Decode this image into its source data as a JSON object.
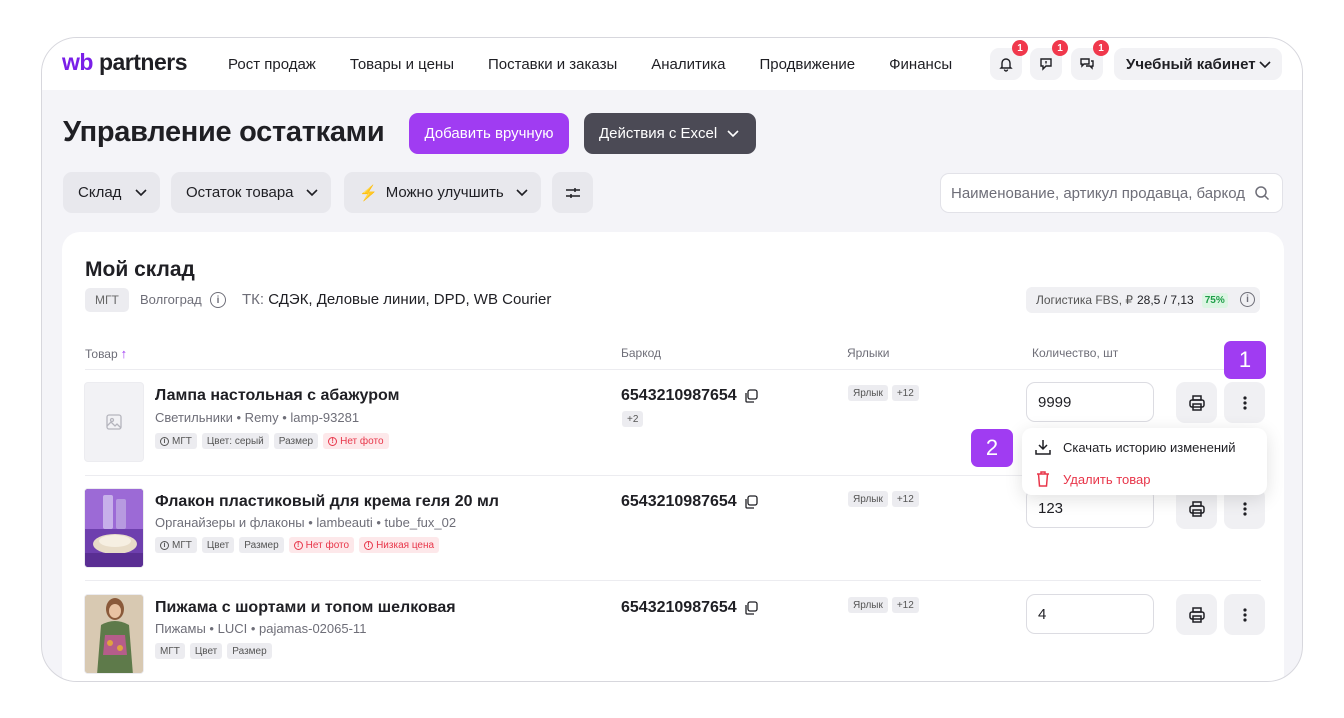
{
  "logo": {
    "wb": "wb",
    "partners": "partners"
  },
  "nav": [
    {
      "label": "Рост продаж"
    },
    {
      "label": "Товары и цены"
    },
    {
      "label": "Поставки и заказы"
    },
    {
      "label": "Аналитика"
    },
    {
      "label": "Продвижение"
    },
    {
      "label": "Финансы"
    }
  ],
  "header_icons": [
    {
      "icon": "bell-icon",
      "badge": "1"
    },
    {
      "icon": "support-chat-icon",
      "badge": "1"
    },
    {
      "icon": "messages-icon",
      "badge": "1"
    }
  ],
  "account": {
    "label": "Учебный кабинет"
  },
  "page": {
    "title": "Управление остатками",
    "add_button": "Добавить вручную",
    "excel_button": "Действия с Excel"
  },
  "filters": {
    "warehouse": "Склад",
    "stock": "Остаток товара",
    "improve": "Можно улучшить",
    "improve_icon": "⚡"
  },
  "search": {
    "placeholder": "Наименование, артикул продавца, баркод"
  },
  "warehouse": {
    "title": "Мой склад",
    "tag": "МГТ",
    "city": "Волгоград",
    "tk_label": "ТК:",
    "tk_value": "СДЭК, Деловые линии, DPD, WB Courier",
    "logistics_label": "Логистика FBS, ₽",
    "logistics_value": "28,5 / 7,13",
    "logistics_pct": "75%"
  },
  "columns": {
    "product": "Товар",
    "sort_arrow": "↑",
    "barcode": "Баркод",
    "labels": "Ярлыки",
    "quantity": "Количество, шт"
  },
  "rows": [
    {
      "name": "Лампа настольная с абажуром",
      "meta": "Светильники • Remy • lamp-93281",
      "chips": [
        "МГТ",
        "Цвет: серый",
        "Размер",
        "Нет фото"
      ],
      "barcode": "6543210987654",
      "barcode_more": "+2",
      "labels": [
        "Ярлык",
        "+12"
      ],
      "quantity": "9999"
    },
    {
      "name": "Флакон пластиковый для крема геля 20 мл",
      "meta": "Органайзеры и флаконы • lambeauti • tube_fux_02",
      "chips": [
        "МГТ",
        "Цвет",
        "Размер",
        "Нет фото",
        "Низкая цена"
      ],
      "barcode": "6543210987654",
      "labels": [
        "Ярлык",
        "+12"
      ],
      "quantity": "123"
    },
    {
      "name": "Пижама с шортами и топом шелковая",
      "meta": "Пижамы • LUCI • pajamas-02065-11",
      "chips": [
        "МГТ",
        "Цвет",
        "Размер"
      ],
      "barcode": "6543210987654",
      "labels": [
        "Ярлык",
        "+12"
      ],
      "quantity": "4"
    }
  ],
  "menu": {
    "download": "Скачать историю изменений",
    "delete": "Удалить товар"
  },
  "steps": {
    "one": "1",
    "two": "2"
  },
  "colors": {
    "accent": "#a03cf2",
    "danger": "#e8364a",
    "dark_button": "#4b4a55"
  }
}
